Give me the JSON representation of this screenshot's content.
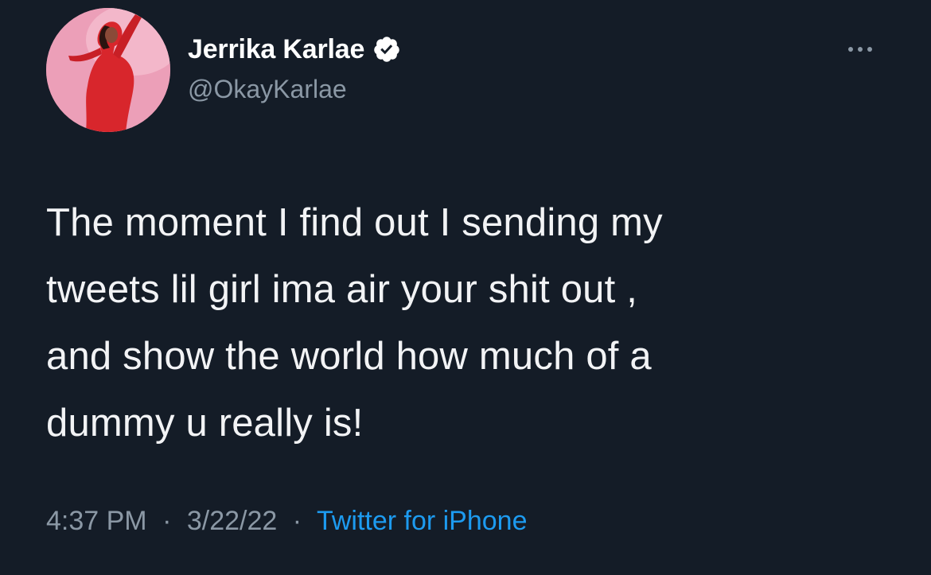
{
  "tweet": {
    "author": {
      "display_name": "Jerrika Karlae",
      "handle": "@OkayKarlae",
      "verified": true,
      "avatar_icon": "profile-photo"
    },
    "text_lines": [
      "The moment I find out I sending my",
      "tweets lil girl ima air your shit out ,",
      "and show the world how much of a",
      "dummy u really is!"
    ],
    "meta": {
      "time": "4:37 PM",
      "separator": "·",
      "date": "3/22/22",
      "source": "Twitter for iPhone"
    }
  },
  "colors": {
    "background": "#141c27",
    "text": "#f2f3f5",
    "secondary": "#8b98a5",
    "link": "#1d9bf0"
  },
  "icons": {
    "verified": "verified-badge-icon",
    "more": "more-options-icon"
  }
}
